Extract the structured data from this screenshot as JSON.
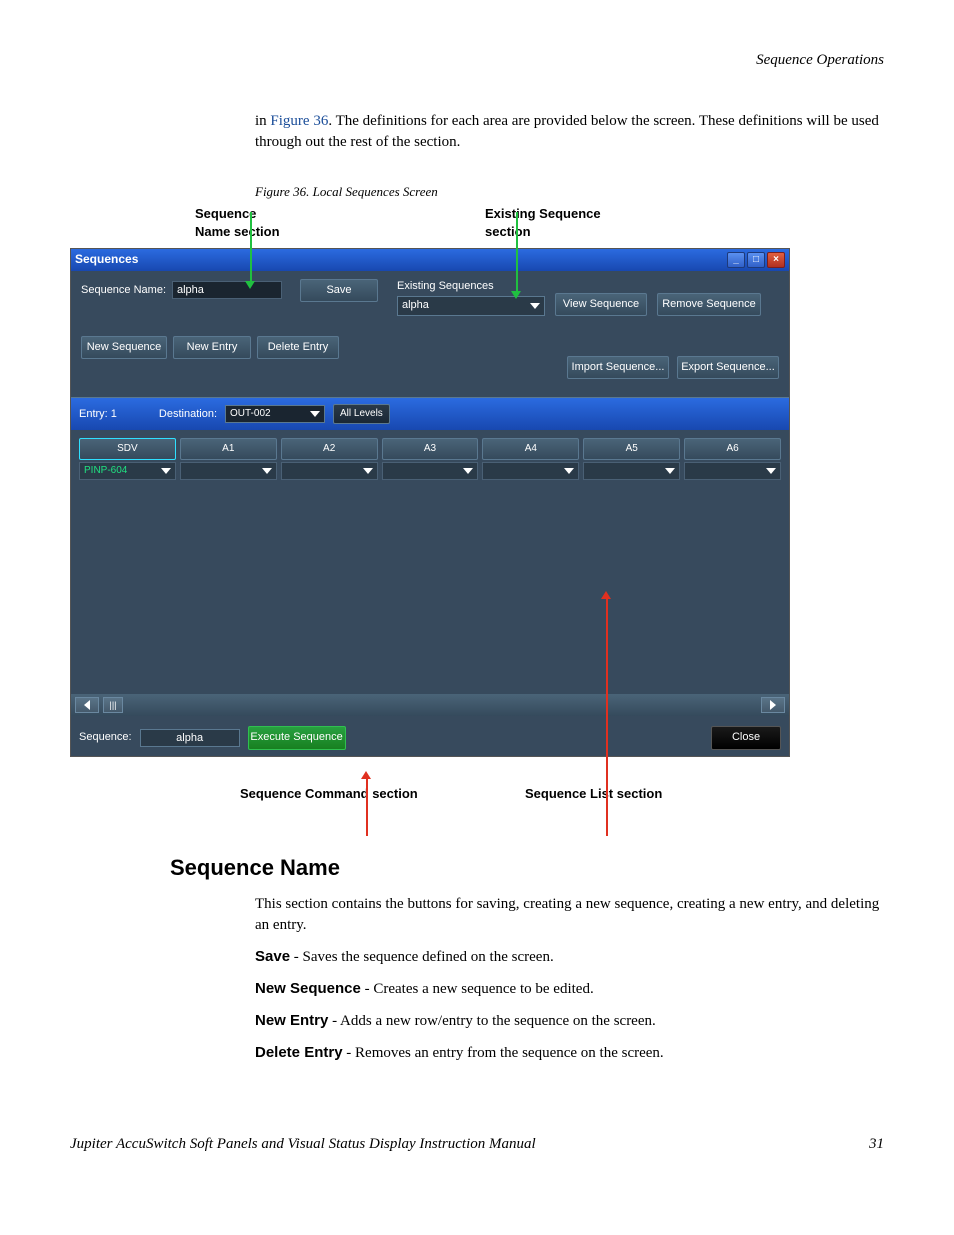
{
  "header": {
    "chapter": "Sequence Operations"
  },
  "intro": {
    "prefix": "in ",
    "figref": "Figure 36",
    "rest": ". The definitions for each area are provided below the screen. These definitions will be used through out the rest of the section."
  },
  "figure": {
    "caption": "Figure 36.  Local Sequences Screen"
  },
  "callouts_top": {
    "c1a": "Sequence",
    "c1b": "Name section",
    "c2a": "Existing Sequence",
    "c2b": "section"
  },
  "callouts_bottom": {
    "c1": "Sequence Command section",
    "c2": "Sequence List section"
  },
  "window": {
    "title": "Sequences",
    "seq_name_label": "Sequence Name:",
    "seq_name_value": "alpha",
    "save": "Save",
    "new_sequence": "New Sequence",
    "new_entry": "New Entry",
    "delete_entry": "Delete Entry",
    "existing_label": "Existing Sequences",
    "existing_value": "alpha",
    "view_sequence": "View Sequence",
    "remove_sequence": "Remove Sequence",
    "import_sequence": "Import Sequence...",
    "export_sequence": "Export Sequence...",
    "entry_label": "Entry: 1",
    "destination_label": "Destination:",
    "destination_value": "OUT-002",
    "all_levels": "All Levels",
    "levels": [
      "SDV",
      "A1",
      "A2",
      "A3",
      "A4",
      "A5",
      "A6"
    ],
    "level0_value": "PINP-604",
    "bottom_sequence_label": "Sequence:",
    "bottom_sequence_value": "alpha",
    "execute": "Execute Sequence",
    "close": "Close"
  },
  "section": {
    "heading": "Sequence Name",
    "para": "This section contains the buttons for saving, creating a new sequence, creating a new entry, and deleting an entry.",
    "items": [
      {
        "term": "Save",
        "desc": " - Saves the sequence defined on the screen."
      },
      {
        "term": "New Sequence",
        "desc": " - Creates a new sequence to be edited."
      },
      {
        "term": "New Entry",
        "desc": " - Adds a new row/entry to the sequence on the screen."
      },
      {
        "term": "Delete Entry",
        "desc": " - Removes an entry from the sequence on the screen."
      }
    ]
  },
  "footer": {
    "title": "Jupiter AccuSwitch Soft Panels and Visual Status Display Instruction Manual",
    "page": "31"
  }
}
